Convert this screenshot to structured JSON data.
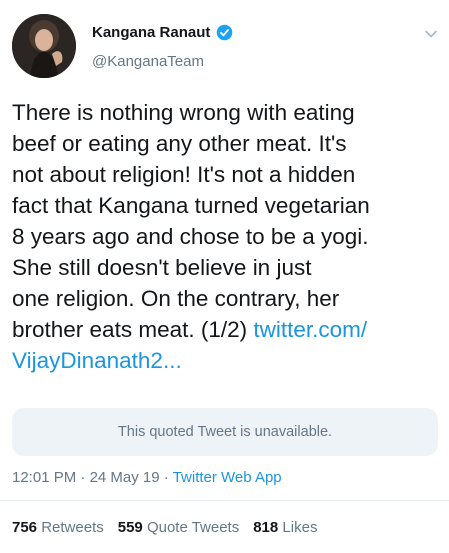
{
  "author": {
    "display_name": "Kangana Ranaut",
    "handle": "@KanganaTeam",
    "verified": true,
    "avatar": "profile-photo"
  },
  "tweet": {
    "lines": [
      "There is nothing wrong with eating",
      "beef or eating any other meat. It's",
      "not about religion! It's not a hidden",
      "fact that Kangana turned vegetarian",
      "8 years ago and chose to be a yogi.",
      "She still doesn't believe in just",
      "one religion. On the contrary, her"
    ],
    "line8_text": "brother eats meat. (1/2) ",
    "link_part1": "twitter.com/",
    "link_part2": "VijayDinanath2..."
  },
  "quote": {
    "text": "This quoted Tweet is unavailable."
  },
  "meta": {
    "time": "12:01 PM",
    "separator": "·",
    "date": "24 May 19",
    "app": "Twitter Web App"
  },
  "stats": {
    "retweets_count": "756",
    "retweets_label": "Retweets",
    "quotes_count": "559",
    "quotes_label": "Quote Tweets",
    "likes_count": "818",
    "likes_label": "Likes"
  },
  "colors": {
    "link": "#1b95e0",
    "secondary_text": "#657786",
    "primary_text": "#14171a",
    "quote_bg": "#eef3f7"
  }
}
